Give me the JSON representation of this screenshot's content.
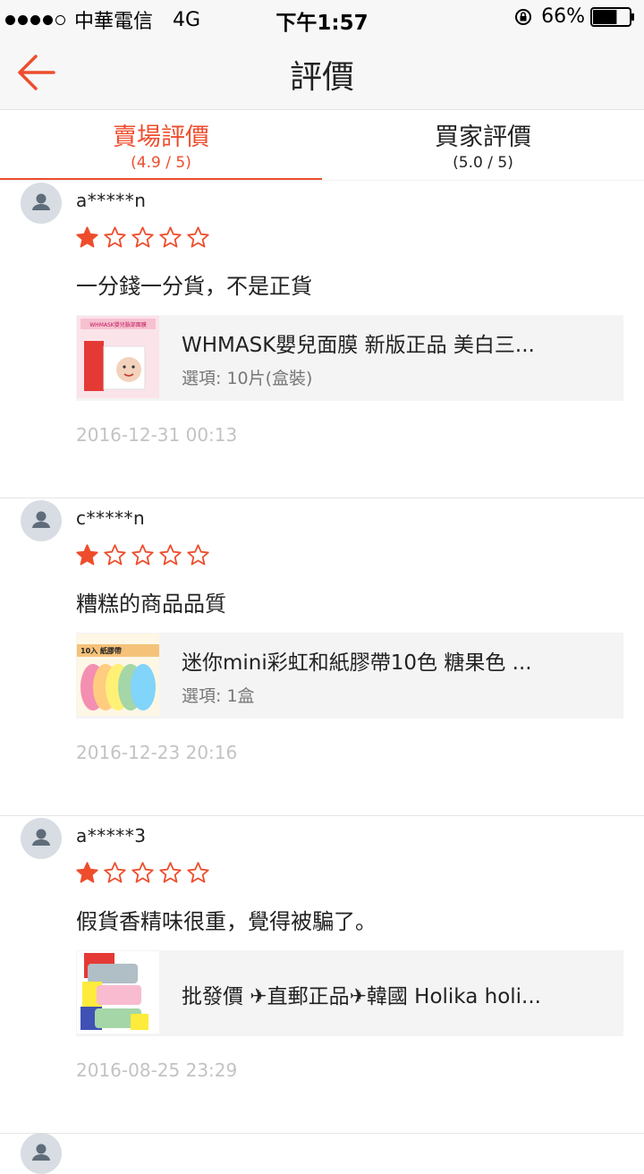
{
  "status_bar": {
    "carrier": "中華電信",
    "network": "4G",
    "time": "下午1:57",
    "battery": "66%",
    "battery_level": 0.66
  },
  "nav": {
    "title": "評價"
  },
  "tabs": [
    {
      "label": "賣場評價",
      "rating": "(4.9 / 5)",
      "active": true
    },
    {
      "label": "買家評價",
      "rating": "(5.0 / 5)",
      "active": false
    }
  ],
  "colors": {
    "accent": "#ee4d2d",
    "timestamp": "#c3c3c3",
    "card_bg": "#f4f4f4"
  },
  "reviews": [
    {
      "user": "a*****n",
      "stars": 1,
      "max_stars": 5,
      "comment": "一分錢一分貨，不是正貨",
      "product_name": "WHMASK嬰兒面膜 新版正品 美白三...",
      "product_option": "選項: 10片(盒裝)",
      "thumb": "face-mask-box-thumbnail",
      "thumb_text": "WHMASK嬰兒臉部面膜",
      "date": "2016-12-31 00:13"
    },
    {
      "user": "c*****n",
      "stars": 1,
      "max_stars": 5,
      "comment": "糟糕的商品品質",
      "product_name": "迷你mini彩虹和紙膠帶10色 糖果色 ...",
      "product_option": "選項: 1盒",
      "thumb": "washi-tape-thumbnail",
      "thumb_text": "10入 紙膠帶",
      "date": "2016-12-23 20:16"
    },
    {
      "user": "a*****3",
      "stars": 1,
      "max_stars": 5,
      "comment": "假貨香精味很重，覺得被騙了。",
      "product_name": "批發價 ✈直郵正品✈韓國 Holika holi...",
      "product_option": "",
      "thumb": "nose-strip-steps-thumbnail",
      "thumb_text": "",
      "date": "2016-08-25 23:29"
    }
  ]
}
